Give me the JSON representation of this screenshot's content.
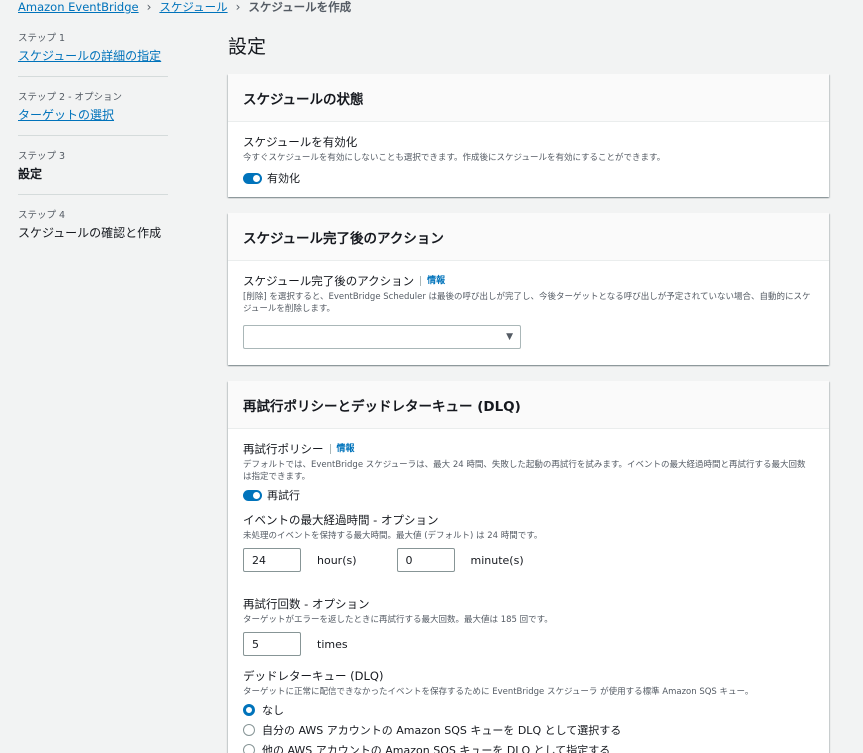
{
  "breadcrumb": {
    "items": [
      "Amazon EventBridge",
      "スケジュール"
    ],
    "current": "スケジュールを作成"
  },
  "steps": [
    {
      "num": "ステップ 1",
      "title": "スケジュールの詳細の指定"
    },
    {
      "num": "ステップ 2 - オプション",
      "title": "ターゲットの選択"
    },
    {
      "num": "ステップ 3",
      "title": "設定"
    },
    {
      "num": "ステップ 4",
      "title": "スケジュールの確認と作成"
    }
  ],
  "page_title": "設定",
  "schedule_state": {
    "header": "スケジュールの状態",
    "label": "スケジュールを有効化",
    "desc": "今すぐスケジュールを有効にしないことも選択できます。作成後にスケジュールを有効にすることができます。",
    "toggle_label": "有効化",
    "enabled": true
  },
  "completion_action": {
    "header": "スケジュール完了後のアクション",
    "label": "スケジュール完了後のアクション",
    "info": "情報",
    "desc": "[削除] を選択すると、EventBridge Scheduler は最後の呼び出しが完了し、今後ターゲットとなる呼び出しが予定されていない場合、自動的にスケジュールを削除します。",
    "selected": ""
  },
  "retry": {
    "header": "再試行ポリシーとデッドレターキュー (DLQ)",
    "policy_label": "再試行ポリシー",
    "info": "情報",
    "policy_desc": "デフォルトでは、EventBridge スケジューラは、最大 24 時間、失敗した起動の再試行を試みます。イベントの最大経過時間と再試行する最大回数は指定できます。",
    "toggle_label": "再試行",
    "enabled": true,
    "max_age_label": "イベントの最大経過時間 - オプション",
    "max_age_desc": "未処理のイベントを保持する最大時間。最大値 (デフォルト) は 24 時間です。",
    "hours_value": "24",
    "hours_unit": "hour(s)",
    "minutes_value": "0",
    "minutes_unit": "minute(s)",
    "attempts_label": "再試行回数 - オプション",
    "attempts_desc": "ターゲットがエラーを返したときに再試行する最大回数。最大値は 185 回です。",
    "attempts_value": "5",
    "attempts_unit": "times",
    "dlq_label": "デッドレターキュー (DLQ)",
    "dlq_desc": "ターゲットに正常に配信できなかったイベントを保存するために EventBridge スケジューラ が使用する標準 Amazon SQS キュー。",
    "dlq_options": [
      "なし",
      "自分の AWS アカウントの Amazon SQS キューを DLQ として選択する",
      "他の AWS アカウントの Amazon SQS キューを DLQ として指定する"
    ],
    "dlq_selected": 0
  },
  "colors": {
    "accent": "#0073bb",
    "background": "#f2f3f3"
  }
}
